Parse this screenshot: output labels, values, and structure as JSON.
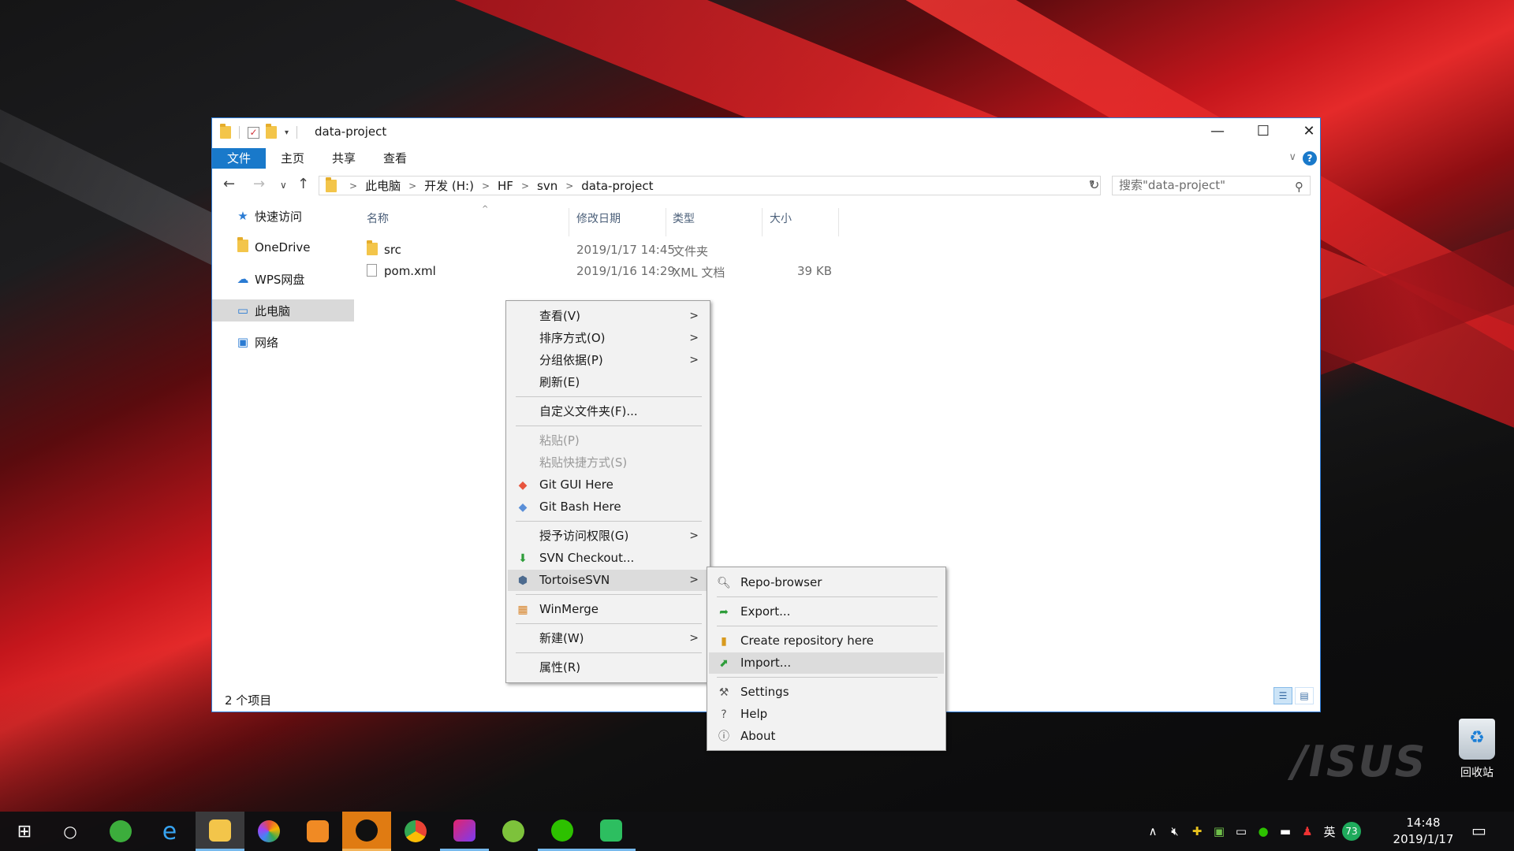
{
  "window": {
    "title": "data-project",
    "caption": {
      "minimize": "—",
      "maximize": "☐",
      "close": "✕"
    }
  },
  "ribbon": {
    "tabs": [
      "文件",
      "主页",
      "共享",
      "查看"
    ]
  },
  "address": {
    "crumbs": [
      "此电脑",
      "开发 (H:)",
      "HF",
      "svn",
      "data-project"
    ],
    "search_placeholder": "搜索\"data-project\""
  },
  "sidebar": {
    "items": [
      {
        "label": "快速访问",
        "icon": "star-icon"
      },
      {
        "label": "OneDrive",
        "icon": "folder-icon"
      },
      {
        "label": "WPS网盘",
        "icon": "cloud-icon"
      },
      {
        "label": "此电脑",
        "icon": "computer-icon"
      },
      {
        "label": "网络",
        "icon": "network-icon"
      }
    ]
  },
  "columns": {
    "name": "名称",
    "modified": "修改日期",
    "type": "类型",
    "size": "大小"
  },
  "files": [
    {
      "name": "src",
      "modified": "2019/1/17 14:45",
      "type": "文件夹",
      "size": ""
    },
    {
      "name": "pom.xml",
      "modified": "2019/1/16 14:29",
      "type": "XML 文档",
      "size": "39 KB"
    }
  ],
  "status": {
    "count": "2 个项目"
  },
  "context_menu": {
    "items": [
      {
        "label": "查看(V)",
        "submenu": true
      },
      {
        "label": "排序方式(O)",
        "submenu": true
      },
      {
        "label": "分组依据(P)",
        "submenu": true
      },
      {
        "label": "刷新(E)"
      },
      {
        "label": "自定义文件夹(F)..."
      },
      {
        "label": "粘贴(P)",
        "disabled": true
      },
      {
        "label": "粘贴快捷方式(S)",
        "disabled": true
      },
      {
        "label": "Git GUI Here",
        "icon": "git-icon"
      },
      {
        "label": "Git Bash Here",
        "icon": "git-icon"
      },
      {
        "label": "授予访问权限(G)",
        "submenu": true
      },
      {
        "label": "SVN Checkout...",
        "icon": "svn-checkout-icon"
      },
      {
        "label": "TortoiseSVN",
        "submenu": true,
        "icon": "tortoise-icon"
      },
      {
        "label": "WinMerge",
        "icon": "winmerge-icon"
      },
      {
        "label": "新建(W)",
        "submenu": true
      },
      {
        "label": "属性(R)"
      }
    ]
  },
  "svn_submenu": {
    "items": [
      {
        "label": "Repo-browser",
        "icon": "repo-browser-icon"
      },
      {
        "label": "Export...",
        "icon": "export-icon"
      },
      {
        "label": "Create repository here",
        "icon": "create-repo-icon"
      },
      {
        "label": "Import...",
        "icon": "import-icon"
      },
      {
        "label": "Settings",
        "icon": "settings-icon"
      },
      {
        "label": "Help",
        "icon": "help-icon"
      },
      {
        "label": "About",
        "icon": "about-icon"
      }
    ]
  },
  "desktop": {
    "recycle_bin": "回收站"
  },
  "taskbar": {
    "tray_lang": "英",
    "tray_badge": "73",
    "time": "14:48",
    "date": "2019/1/17"
  }
}
